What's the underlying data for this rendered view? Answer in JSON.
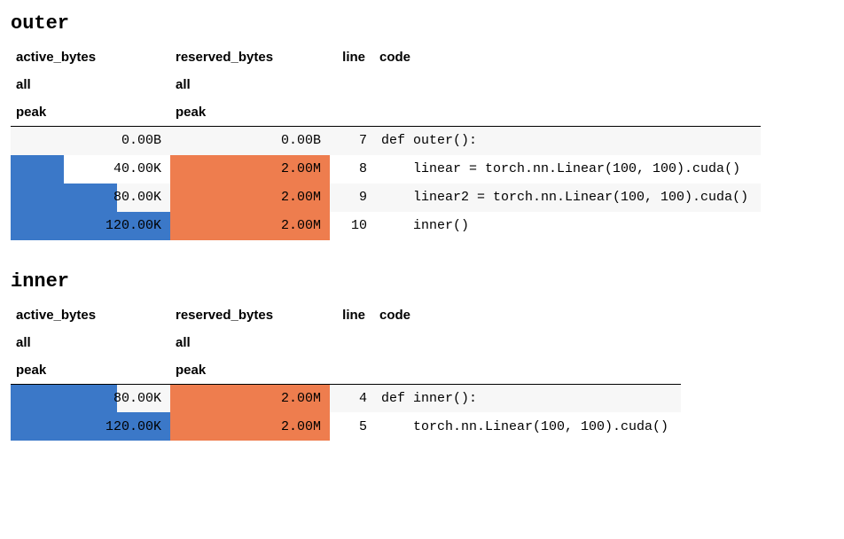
{
  "columns": [
    {
      "h1": "active_bytes",
      "h2": "all",
      "h3": "peak"
    },
    {
      "h1": "reserved_bytes",
      "h2": "all",
      "h3": "peak"
    },
    {
      "h1": "line",
      "h2": "",
      "h3": ""
    },
    {
      "h1": "code",
      "h2": "",
      "h3": ""
    }
  ],
  "sections": [
    {
      "id": "outer",
      "title": "outer",
      "active_max": 120.0,
      "reserved_max": 2.0,
      "rows": [
        {
          "active": "0.00B",
          "active_frac": 0.0,
          "reserved": "0.00B",
          "reserved_frac": 0.0,
          "line": "7",
          "code": "def outer():"
        },
        {
          "active": "40.00K",
          "active_frac": 0.3333,
          "reserved": "2.00M",
          "reserved_frac": 1.0,
          "line": "8",
          "code": "    linear = torch.nn.Linear(100, 100).cuda()"
        },
        {
          "active": "80.00K",
          "active_frac": 0.6667,
          "reserved": "2.00M",
          "reserved_frac": 1.0,
          "line": "9",
          "code": "    linear2 = torch.nn.Linear(100, 100).cuda()"
        },
        {
          "active": "120.00K",
          "active_frac": 1.0,
          "reserved": "2.00M",
          "reserved_frac": 1.0,
          "line": "10",
          "code": "    inner()"
        }
      ]
    },
    {
      "id": "inner",
      "title": "inner",
      "active_max": 120.0,
      "reserved_max": 2.0,
      "rows": [
        {
          "active": "80.00K",
          "active_frac": 0.6667,
          "reserved": "2.00M",
          "reserved_frac": 1.0,
          "line": "4",
          "code": "def inner():"
        },
        {
          "active": "120.00K",
          "active_frac": 1.0,
          "reserved": "2.00M",
          "reserved_frac": 1.0,
          "line": "5",
          "code": "    torch.nn.Linear(100, 100).cuda()"
        }
      ]
    }
  ],
  "chart_data": [
    {
      "type": "table",
      "title": "outer",
      "columns": [
        "active_bytes.all.peak",
        "reserved_bytes.all.peak",
        "line",
        "code"
      ],
      "rows": [
        [
          "0.00B",
          "0.00B",
          7,
          "def outer():"
        ],
        [
          "40.00K",
          "2.00M",
          8,
          "    linear = torch.nn.Linear(100, 100).cuda()"
        ],
        [
          "80.00K",
          "2.00M",
          9,
          "    linear2 = torch.nn.Linear(100, 100).cuda()"
        ],
        [
          "120.00K",
          "2.00M",
          10,
          "    inner()"
        ]
      ]
    },
    {
      "type": "table",
      "title": "inner",
      "columns": [
        "active_bytes.all.peak",
        "reserved_bytes.all.peak",
        "line",
        "code"
      ],
      "rows": [
        [
          "80.00K",
          "2.00M",
          4,
          "def inner():"
        ],
        [
          "120.00K",
          "2.00M",
          5,
          "    torch.nn.Linear(100, 100).cuda()"
        ]
      ]
    }
  ]
}
